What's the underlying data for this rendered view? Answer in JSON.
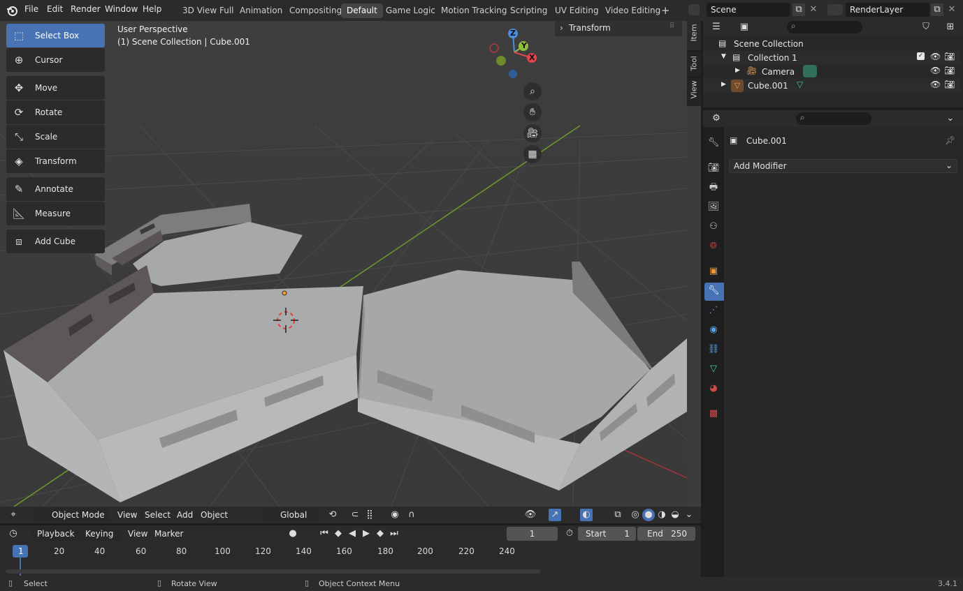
{
  "topbar": {
    "menus": [
      "File",
      "Edit",
      "Render",
      "Window",
      "Help"
    ],
    "workspaces": [
      "3D View Full",
      "Animation",
      "Compositing",
      "Default",
      "Game Logic",
      "Motion Tracking",
      "Scripting",
      "UV Editing",
      "Video Editing"
    ],
    "active_workspace": "Default",
    "add_workspace": "+",
    "scene_name": "Scene",
    "render_layer": "RenderLayer"
  },
  "viewport": {
    "perspective_label": "User Perspective",
    "context_label": "(1) Scene Collection | Cube.001",
    "transform_panel": "Transform",
    "tabs": [
      "Item",
      "Tool",
      "View"
    ],
    "gizmo_axes": [
      "Z",
      "Y",
      "X"
    ],
    "tools": [
      {
        "label": "Select Box",
        "icon": "select-box-icon",
        "active": true
      },
      {
        "label": "Cursor",
        "icon": "cursor-icon"
      },
      {
        "label": "Move",
        "icon": "move-icon"
      },
      {
        "label": "Rotate",
        "icon": "rotate-icon"
      },
      {
        "label": "Scale",
        "icon": "scale-icon"
      },
      {
        "label": "Transform",
        "icon": "transform-icon"
      },
      {
        "label": "Annotate",
        "icon": "annotate-icon"
      },
      {
        "label": "Measure",
        "icon": "measure-icon"
      },
      {
        "label": "Add Cube",
        "icon": "add-cube-icon"
      }
    ]
  },
  "viewport_header": {
    "mode": "Object Mode",
    "menus": [
      "View",
      "Select",
      "Add",
      "Object"
    ],
    "orientation": "Global"
  },
  "timeline": {
    "menus": [
      "Playback",
      "Keying",
      "View",
      "Marker"
    ],
    "current_frame": "1",
    "start_label": "Start",
    "start_value": "1",
    "end_label": "End",
    "end_value": "250",
    "ticks": [
      "1",
      "20",
      "40",
      "60",
      "80",
      "100",
      "120",
      "140",
      "160",
      "180",
      "200",
      "220",
      "240"
    ]
  },
  "outliner": {
    "root": "Scene Collection",
    "collection": "Collection 1",
    "items": [
      "Camera",
      "Cube.001"
    ]
  },
  "properties": {
    "object_name": "Cube.001",
    "add_modifier": "Add Modifier"
  },
  "statusbar": {
    "select": "Select",
    "rotate_view": "Rotate View",
    "context_menu": "Object Context Menu",
    "version": "3.4.1"
  },
  "colors": {
    "accent": "#4772b3",
    "axis_x": "#e2434f",
    "axis_y": "#8fbf3a",
    "axis_z": "#4a8fe0"
  }
}
